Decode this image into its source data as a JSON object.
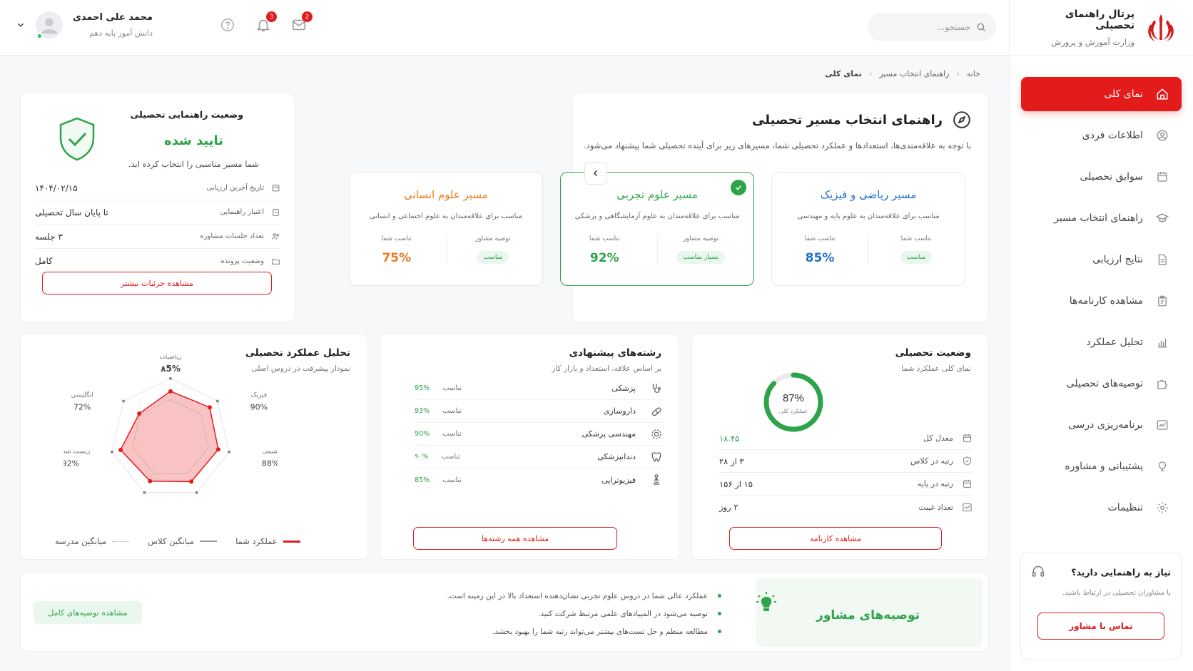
{
  "brand": {
    "title": "پرتال راهنمای تحصیلی",
    "subtitle": "وزارت آموزش و پرورش"
  },
  "sidebar": {
    "items": [
      {
        "label": "نمای کلی",
        "icon": "home-icon",
        "active": true
      },
      {
        "label": "اطلاعات فردی",
        "icon": "user-icon"
      },
      {
        "label": "سوابق تحصیلی",
        "icon": "calendar-icon"
      },
      {
        "label": "راهنمای انتخاب مسیر",
        "icon": "graduation-cap-icon"
      },
      {
        "label": "نتایج ارزیابی",
        "icon": "document-icon"
      },
      {
        "label": "مشاهده کارنامه‌ها",
        "icon": "clipboard-icon"
      },
      {
        "label": "تحلیل عملکرد",
        "icon": "bar-chart-icon"
      },
      {
        "label": "توصیه‌های تحصیلی",
        "icon": "puzzle-icon"
      },
      {
        "label": "برنامه‌ریزی درسی",
        "icon": "trend-icon"
      },
      {
        "label": "پشتیبانی و مشاوره",
        "icon": "support-icon"
      },
      {
        "label": "تنظیمات",
        "icon": "gear-icon"
      }
    ],
    "help": {
      "title": "نیاز به راهنمایی دارید؟",
      "text": "با مشاوران تحصیلی در ارتباط باشید.",
      "button": "تماس با مشاور"
    }
  },
  "topbar": {
    "search_placeholder": "جستجو...",
    "notifications_count": "3",
    "messages_count": "2",
    "user": {
      "name": "محمد علی احمدی",
      "role": "دانش آموز پایه دهم"
    }
  },
  "breadcrumb": [
    "خانه",
    "راهنمای انتخاب مسیر",
    "نمای کلی"
  ],
  "guide": {
    "title": "راهنمای انتخاب مسیر تحصیلی",
    "description": "با توجه به علاقه‌مندی‌ها، استعدادها و عملکرد تحصیلی شما، مسیرهای زیر برای آینده تحصیلی شما پیشنهاد می‌شود.",
    "paths": [
      {
        "title": "مسیر ریاضی و فیزیک",
        "desc": "مناسب برای علاقه‌مندان به علوم پایه و مهندسی",
        "rec_label": "تناسب شما",
        "rec_value": "مناسب",
        "fit_label": "تناسب شما",
        "fit_value": "85%",
        "color": "#1f6fd1",
        "selected": false
      },
      {
        "title": "مسیر علوم تجربی",
        "desc": "مناسب برای علاقه‌مندان به علوم آزمایشگاهی و پزشکی",
        "rec_label": "توصیه مشاور",
        "rec_value": "بسیار مناسب",
        "fit_label": "تناسب شما",
        "fit_value": "92%",
        "color": "#2ca44a",
        "selected": true
      },
      {
        "title": "مسیر علوم انسانی",
        "desc": "مناسب برای علاقه‌مندان به علوم اجتماعی و انسانی",
        "rec_label": "توصیه مشاور",
        "rec_value": "مناسب",
        "fit_label": "تناسب شما",
        "fit_value": "75%",
        "color": "#ea7a1e",
        "selected": false
      }
    ]
  },
  "status": {
    "title": "وضعیت راهنمایی تحصیلی",
    "state": "تایید شده",
    "message": "شما مسیر مناسبی را انتخاب کرده اید.",
    "rows": [
      {
        "key": "تاریخ آخرین ارزیابی",
        "value": "۱۴۰۴/۰۲/۱۵",
        "icon": "calendar-icon"
      },
      {
        "key": "اعتبار راهنمایی",
        "value": "تا پایان سال تحصیلی",
        "icon": "clipboard-icon"
      },
      {
        "key": "تعداد جلسات مشاوره",
        "value": "۳ جلسه",
        "icon": "users-icon"
      },
      {
        "key": "وضعیت پرونده",
        "value": "کامل",
        "icon": "folder-icon"
      }
    ],
    "button": "مشاهده جزئیات بیشتر"
  },
  "edu": {
    "title": "وضعیت تحصیلی",
    "subtitle": "نمای کلی عملکرد شما",
    "ring_value": "87%",
    "ring_fraction": 0.87,
    "ring_label": "عملکرد کلی",
    "rows": [
      {
        "key": "معدل کل",
        "value": "۱۸.۴۵",
        "icon": "calendar-icon",
        "green": true
      },
      {
        "key": "رتبه در کلاس",
        "value": "۳ از ۲۸",
        "icon": "shield-icon"
      },
      {
        "key": "رتبه در پایه",
        "value": "۱۵ از ۱۵۶",
        "icon": "calendar-icon"
      },
      {
        "key": "تعداد غیبت",
        "value": "۲ روز",
        "icon": "trend-icon"
      }
    ],
    "button": "مشاهده کارنامه"
  },
  "fields": {
    "title": "رشته‌های پیشنهادی",
    "subtitle": "بر اساس علاقه، استعداد و بازار کار",
    "rows": [
      {
        "name": "پزشکی",
        "fit_label": "تناسب",
        "fit": "95%",
        "icon": "stethoscope-icon"
      },
      {
        "name": "داروسازی",
        "fit_label": "تناسب",
        "fit": "93%",
        "icon": "pill-icon"
      },
      {
        "name": "مهندسی پزشکی",
        "fit_label": "تناسب",
        "fit": "90%",
        "icon": "gear-icon"
      },
      {
        "name": "دندانپزشکی",
        "fit_label": "تناسب",
        "fit": "۹۰%",
        "icon": "tooth-icon"
      },
      {
        "name": "فیزیوتراپی",
        "fit_label": "تناسب",
        "fit": "85%",
        "icon": "person-icon"
      }
    ],
    "button": "مشاهده همه رشته‌ها"
  },
  "radar": {
    "title": "تحلیل عملکرد تحصیلی",
    "subtitle": "نمودار پیشرفت در دروس اصلی",
    "legend": {
      "you": "عملکرد شما",
      "class": "میانگین کلاس",
      "school": "میانگین مدرسه"
    }
  },
  "chart_data": {
    "type": "radar",
    "categories": [
      "ریاضیات",
      "فیزیک",
      "شیمی",
      "زیست شناسی",
      "انگلیسی"
    ],
    "value_labels": [
      "۸5%",
      "90%",
      "88%",
      "92%",
      "72%"
    ],
    "series": [
      {
        "name": "عملکرد شما",
        "values": [
          85,
          90,
          88,
          86,
          85,
          92,
          72
        ],
        "color": "#e31b1b"
      },
      {
        "name": "میانگین کلاس",
        "values": [
          70,
          70,
          70,
          70,
          70,
          70,
          70
        ],
        "color": "#888888"
      }
    ],
    "axes": 7,
    "ylim": [
      0,
      100
    ]
  },
  "recommendations": {
    "title": "توصیه‌های مشاور",
    "items": [
      "عملکرد عالی شما در دروس علوم تجربی نشان‌دهنده استعداد بالا در این زمینه است.",
      "توصیه می‌شود در المپیادهای علمی مرتبط شرکت کنید.",
      "مطالعه منظم و حل تست‌های بیشتر می‌تواند رتبه شما را بهبود بخشد."
    ],
    "button": "مشاهده توصیه‌های کامل"
  }
}
